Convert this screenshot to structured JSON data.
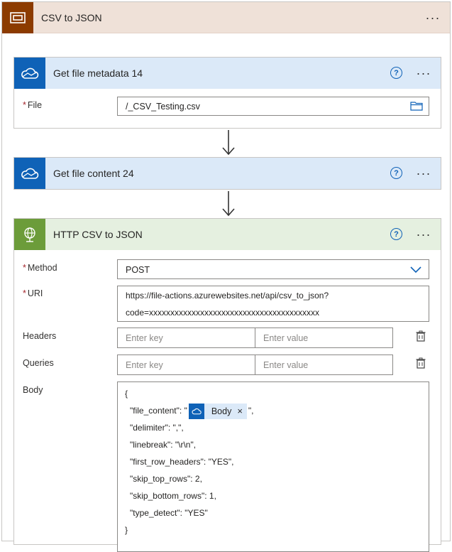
{
  "scope": {
    "title": "CSV to JSON",
    "more": "···"
  },
  "metadata_card": {
    "title": "Get file metadata 14",
    "file_label": "File",
    "file_value": "/_CSV_Testing.csv"
  },
  "content_card": {
    "title": "Get file content 24"
  },
  "http_card": {
    "title": "HTTP CSV to JSON",
    "method_label": "Method",
    "method_value": "POST",
    "uri_label": "URI",
    "uri_line1": "https://file-actions.azurewebsites.net/api/csv_to_json?",
    "uri_line2": "code=xxxxxxxxxxxxxxxxxxxxxxxxxxxxxxxxxxxxxxxx",
    "headers_label": "Headers",
    "queries_label": "Queries",
    "key_placeholder": "Enter key",
    "value_placeholder": "Enter value",
    "body_label": "Body",
    "body": {
      "open": "{",
      "file_content_prefix": "\"file_content\": \"",
      "token_label": "Body",
      "token_close": "×",
      "file_content_suffix": "\",",
      "line_delimiter": "\"delimiter\": \",\",",
      "line_linebreak": "\"linebreak\": \"\\r\\n\",",
      "line_first_row": "\"first_row_headers\": \"YES\",",
      "line_skip_top": "\"skip_top_rows\": 2,",
      "line_skip_bottom": "\"skip_bottom_rows\": 1,",
      "line_type_detect": "\"type_detect\": \"YES\"",
      "close": "}"
    }
  },
  "common": {
    "help": "?",
    "more": "···",
    "required_mark": "*"
  },
  "colors": {
    "scope_icon": "#8c3b00",
    "scope_header": "#efe1d8",
    "onedrive_header": "#dbe9f8",
    "onedrive_icon": "#0f62b7",
    "http_header": "#e5f0e0",
    "http_icon": "#6c9c3a"
  },
  "icons": {
    "scope": "scope-icon",
    "onedrive": "onedrive-cloud-icon",
    "http": "http-globe-icon",
    "folder": "folder-icon",
    "chevron": "chevron-down-icon",
    "delete": "trash-icon"
  }
}
